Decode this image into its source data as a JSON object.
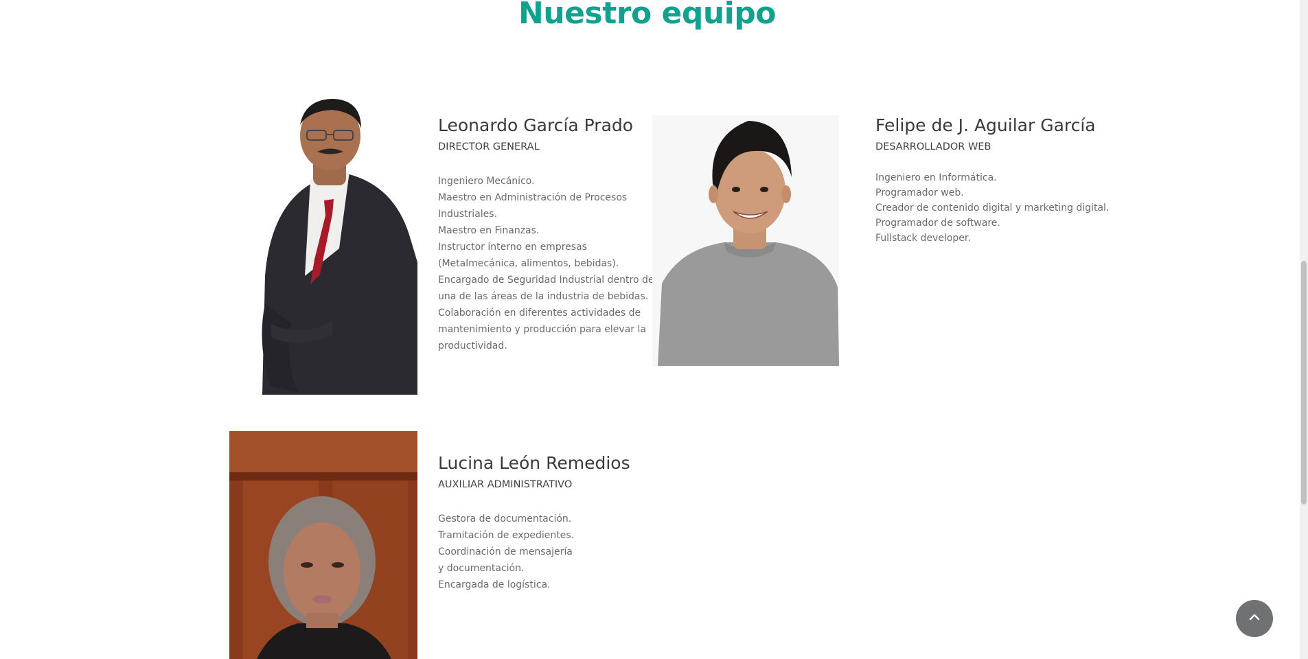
{
  "section": {
    "title": "Nuestro equipo"
  },
  "members": [
    {
      "name": "Leonardo García Prado",
      "role": "DIRECTOR GENERAL",
      "desc": [
        "Ingeniero Mecánico.",
        "Maestro en Administración de Procesos",
        "Industriales.",
        "Maestro en Finanzas.",
        "Instructor interno en empresas",
        "(Metalmecánica, alimentos, bebidas).",
        "Encargado de Seguridad Industrial dentro de",
        "una de las áreas de la industria de bebidas.",
        "Colaboración en diferentes actividades de",
        "mantenimiento y producción para elevar la",
        "productividad."
      ]
    },
    {
      "name": "Felipe de J. Aguilar García",
      "role": "DESARROLLADOR WEB",
      "desc": [
        "Ingeniero en Informática.",
        "Programador web.",
        "Creador de contenido digital y marketing digital.",
        "Programador de software.",
        "Fullstack developer."
      ]
    },
    {
      "name": "Lucina León Remedios",
      "role": "AUXILIAR ADMINISTRATIVO",
      "desc": [
        "Gestora de documentación.",
        "Tramitación de expedientes.",
        "Coordinación de mensajería",
        "y documentación.",
        "Encargada de logística."
      ]
    }
  ],
  "ui": {
    "back_to_top_icon": "chevron-up-icon",
    "accent_color": "#10a28f"
  }
}
